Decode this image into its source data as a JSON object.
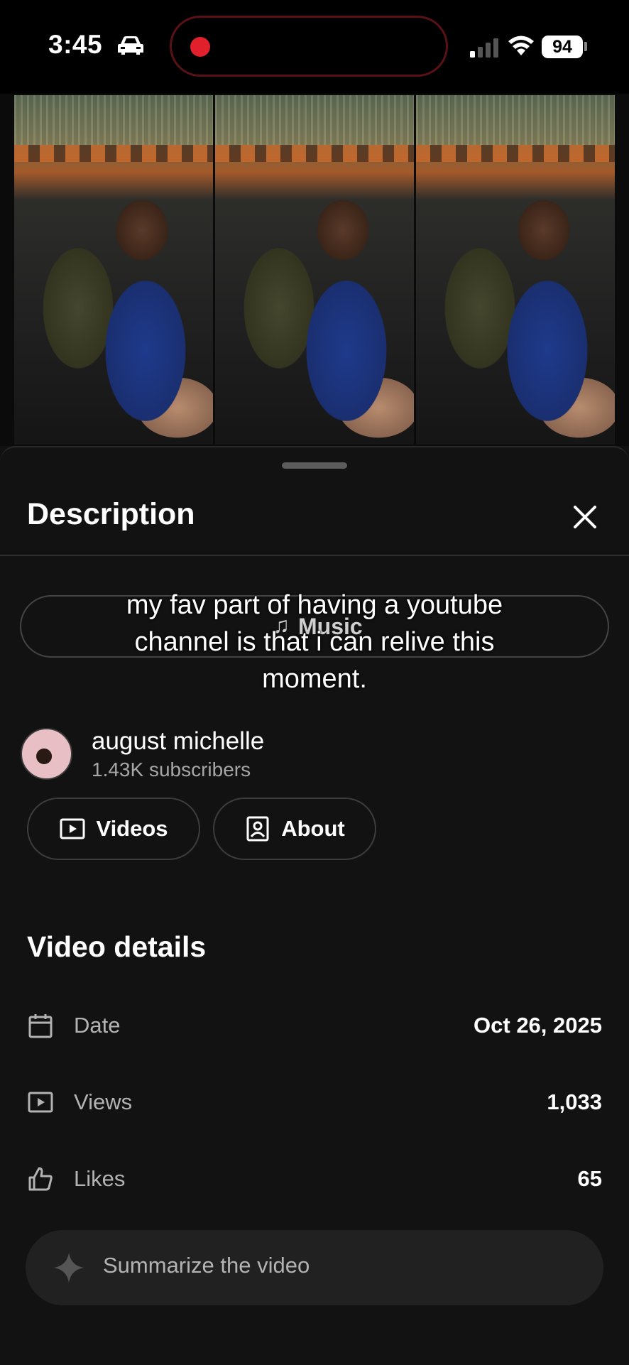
{
  "status_bar": {
    "time": "3:45",
    "battery": "94"
  },
  "description": {
    "title": "Description"
  },
  "overlay_caption": "my fav part of having a youtube channel is that i can relive this moment.",
  "music": {
    "label": "Music"
  },
  "channel": {
    "name": "august michelle",
    "subscribers": "1.43K subscribers"
  },
  "channel_buttons": {
    "videos": "Videos",
    "about": "About"
  },
  "video_details": {
    "title": "Video details",
    "rows": [
      {
        "icon": "calendar-icon",
        "label": "Date",
        "value": "Oct 26, 2025"
      },
      {
        "icon": "play-icon",
        "label": "Views",
        "value": "1,033"
      },
      {
        "icon": "thumbs-up-icon",
        "label": "Likes",
        "value": "65"
      }
    ]
  },
  "summarize": {
    "label": "Summarize the video"
  }
}
